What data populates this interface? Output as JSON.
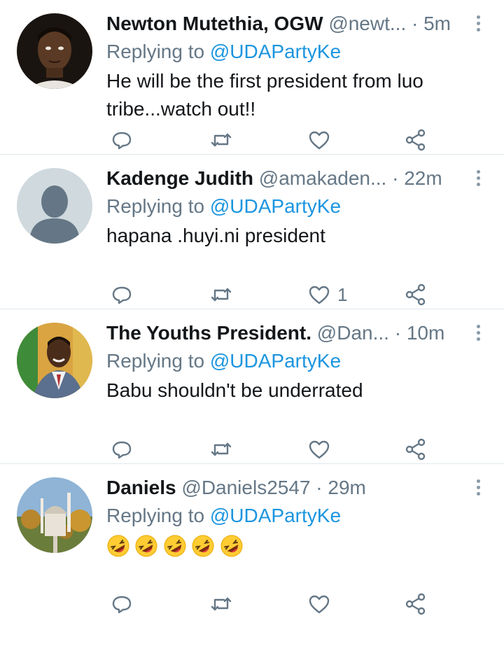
{
  "tweets": [
    {
      "name": "Newton Mutethia, OGW",
      "handle": "@newt...",
      "time": "· 5m",
      "reply_label": "Replying to",
      "reply_to": "@UDAPartyKe",
      "text_lines": [
        "He will be the first president from luo",
        "tribe...watch out!!"
      ],
      "likes": ""
    },
    {
      "name": "Kadenge Judith",
      "handle": "@amakaden...",
      "time": "· 22m",
      "reply_label": "Replying to",
      "reply_to": "@UDAPartyKe",
      "text_lines": [
        "hapana .huyi.ni president"
      ],
      "likes": "1"
    },
    {
      "name": "The Youths President.",
      "handle": "@Dan...",
      "time": "· 10m",
      "reply_label": "Replying to",
      "reply_to": "@UDAPartyKe",
      "text_lines": [
        "Babu shouldn't be underrated"
      ],
      "likes": ""
    },
    {
      "name": "Daniels",
      "handle": "@Daniels2547",
      "time": "· 29m",
      "reply_label": "Replying to",
      "reply_to": "@UDAPartyKe",
      "emoji_count": 5,
      "emoji_name": "rolling-on-floor-laughing-emoji",
      "likes": ""
    }
  ],
  "colors": {
    "accent": "#1b95e0",
    "muted": "#657786",
    "divider": "#e1e8ed"
  },
  "icons": [
    "reply-icon",
    "retweet-icon",
    "like-icon",
    "share-icon",
    "more-options-icon"
  ]
}
